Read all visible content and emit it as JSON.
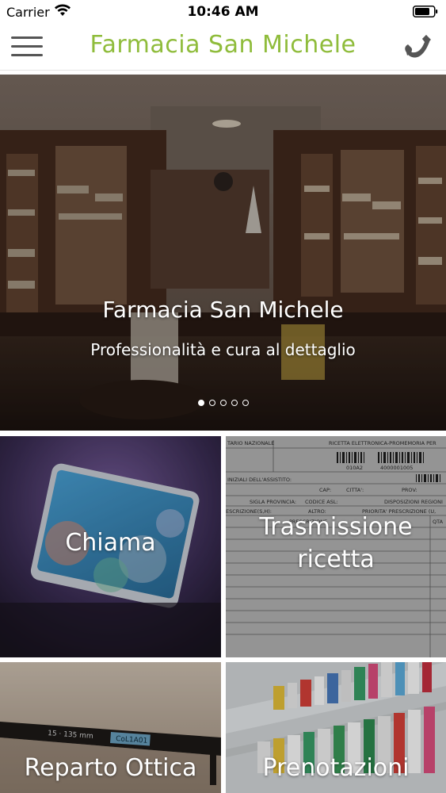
{
  "status_bar": {
    "carrier": "Carrier",
    "time": "10:46 AM"
  },
  "nav": {
    "title": "Farmacia San Michele",
    "menu_icon": "hamburger-menu-icon",
    "phone_icon": "phone-icon",
    "title_color": "#8fbc3b"
  },
  "hero": {
    "title": "Farmacia San Michele",
    "subtitle": "Professionalità e cura al dettaglio",
    "slide_count": 5,
    "active_slide": 1
  },
  "tiles": [
    {
      "label": "Chiama"
    },
    {
      "label_line1": "Trasmissione",
      "label_line2": "ricetta"
    },
    {
      "label": "Reparto Ottica"
    },
    {
      "label": "Prenotazioni"
    }
  ],
  "ricetta_form": {
    "left_header": "TARIO NAZIONALE",
    "right_header": "RICETTA ELETTRONICA-PROMEMORIA PER",
    "code1": "010A2",
    "code2": "4000001005",
    "row1": "INIZIALI DELL'ASSISTITO:",
    "row2a": "CAP:",
    "row2b": "CITTA':",
    "row2c": "PROV:",
    "row3a": "SIGLA PROVINCIA:",
    "row3b": "CODICE ASL:",
    "row3c": "DISPOSIZIONI REGIONI",
    "row4a": "ESCRIZIONE(S,H):",
    "row4b": "ALTRO:",
    "row4c": "PRIORITA' PRESCRIZIONE (U,",
    "row5a": "PRESCRIZIONE",
    "row5b": "QTA"
  },
  "ottica_text": {
    "frame_size": "15 · 135 mm",
    "brand": "CoL1A01"
  }
}
